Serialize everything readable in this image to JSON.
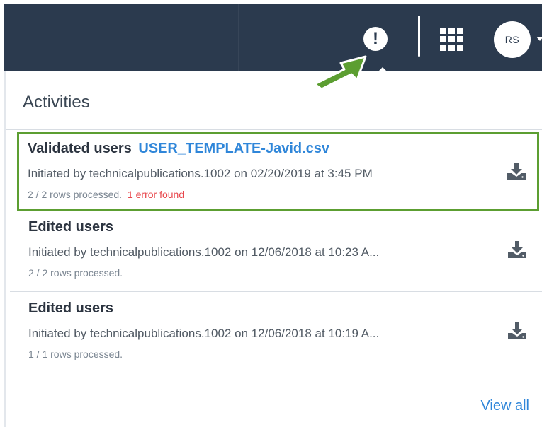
{
  "topbar": {
    "alert_icon": "exclamation-icon",
    "apps_icon": "grid-icon",
    "avatar_initials": "RS",
    "avatar_caret_icon": "caret-down-icon",
    "background_color": "#2b3a4e"
  },
  "annotation": {
    "arrow_icon": "pointer-arrow-icon",
    "arrow_color": "#5c9e31",
    "highlight_color": "#5c9e31"
  },
  "panel": {
    "title": "Activities",
    "view_all_label": "View all",
    "download_icon": "download-icon"
  },
  "activities": [
    {
      "title": "Validated users",
      "file": "USER_TEMPLATE-Javid.csv",
      "initiated": "Initiated by technicalpublications.1002 on 02/20/2019 at 3:45 PM",
      "rows": "2 / 2 rows processed.",
      "error": "1 error found"
    },
    {
      "title": "Edited users",
      "initiated": "Initiated by technicalpublications.1002 on 12/06/2018 at 10:23 A...",
      "rows": "2 / 2 rows processed."
    },
    {
      "title": "Edited users",
      "initiated": "Initiated by technicalpublications.1002 on 12/06/2018 at 10:19 A...",
      "rows": "1 / 1 rows processed."
    }
  ],
  "colors": {
    "link": "#2f86d9",
    "error": "#e8474c"
  }
}
